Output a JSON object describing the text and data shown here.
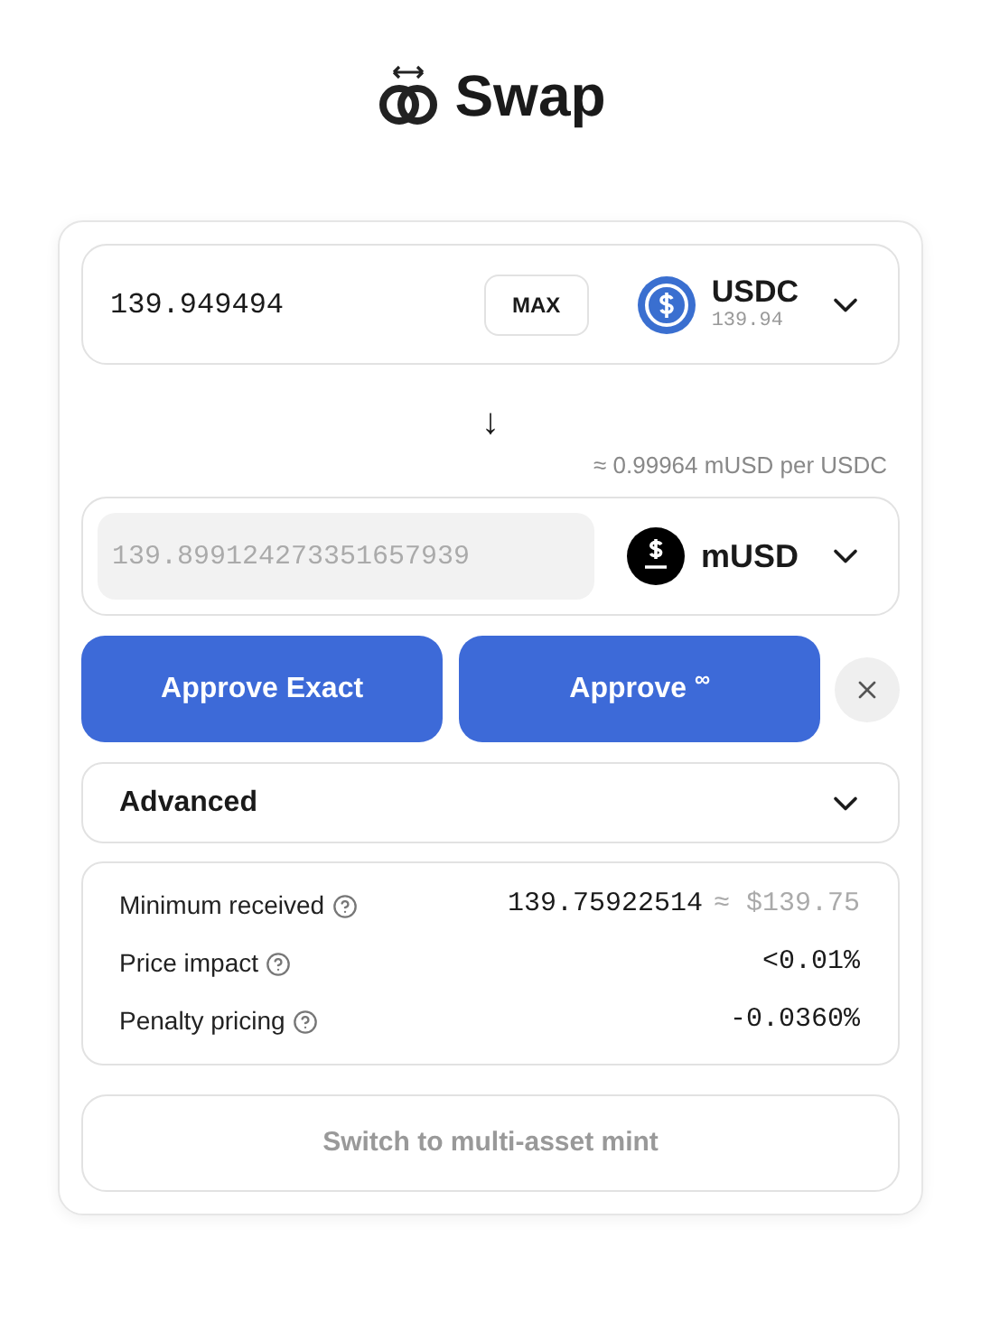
{
  "title": "Swap",
  "input": {
    "value": "139.949494",
    "max_label": "MAX",
    "token": "USDC",
    "balance": "139.94"
  },
  "arrow": "↓",
  "rate": "≈ 0.99964 mUSD per USDC",
  "output": {
    "value": "139.899124273351657939",
    "token": "mUSD"
  },
  "buttons": [
    {
      "label": "Approve Exact"
    },
    {
      "label": "Approve $^{∞}$"
    }
  ],
  "advanced": {
    "label": "Advanced",
    "expanded": false
  },
  "details": [
    {
      "label": "Minimum received",
      "value": "139.75922514",
      "usd": "≈ $139.75"
    },
    {
      "label": "Price impact",
      "value": "<0.01%"
    },
    {
      "label": "Penalty pricing",
      "value": "-0.0360%"
    }
  ],
  "switch_button": {
    "label": "Switch to multi-asset mint",
    "disabled": true
  }
}
